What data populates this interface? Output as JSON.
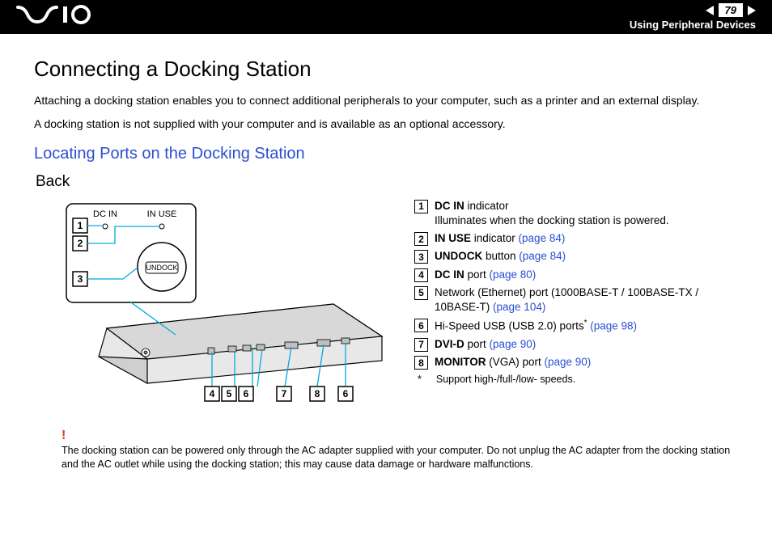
{
  "header": {
    "logo": "⌓ΛΙΟ",
    "page_number": "79",
    "section": "Using Peripheral Devices"
  },
  "title": "Connecting a Docking Station",
  "intro1": "Attaching a docking station enables you to connect additional peripherals to your computer, such as a printer and an external display.",
  "intro2": "A docking station is not supplied with your computer and is available as an optional accessory.",
  "subtitle": "Locating Ports on the Docking Station",
  "view_label": "Back",
  "diagram_labels": {
    "dc_in": "DC IN",
    "in_use": "IN USE",
    "undock": "UNDOCK"
  },
  "callouts": [
    "1",
    "2",
    "3",
    "4",
    "5",
    "6",
    "7",
    "8",
    "6"
  ],
  "legend": [
    {
      "n": "1",
      "bold": "DC IN",
      "text": " indicator",
      "line2": "Illuminates when the docking station is powered."
    },
    {
      "n": "2",
      "bold": "IN USE",
      "text": " indicator ",
      "link": "(page 84)"
    },
    {
      "n": "3",
      "bold": "UNDOCK",
      "text": " button ",
      "link": "(page 84)"
    },
    {
      "n": "4",
      "bold": "DC IN",
      "text": " port ",
      "link": "(page 80)"
    },
    {
      "n": "5",
      "text": "Network (Ethernet) port (1000BASE-T / 100BASE-TX / 10BASE-T) ",
      "link": "(page 104)"
    },
    {
      "n": "6",
      "text": "Hi-Speed USB (USB 2.0) ports",
      "sup": "*",
      "post": " ",
      "link": "(page 98)"
    },
    {
      "n": "7",
      "bold": "DVI-D",
      "text": " port ",
      "link": "(page 90)"
    },
    {
      "n": "8",
      "bold": "MONITOR",
      "text": " (VGA) port ",
      "link": "(page 90)"
    }
  ],
  "footnote": {
    "mark": "*",
    "text": "Support high-/full-/low- speeds."
  },
  "warning": {
    "mark": "!",
    "text": "The docking station can be powered only through the AC adapter supplied with your computer. Do not unplug the AC adapter from the docking station and the AC outlet while using the docking station; this may cause data damage or hardware malfunctions."
  }
}
